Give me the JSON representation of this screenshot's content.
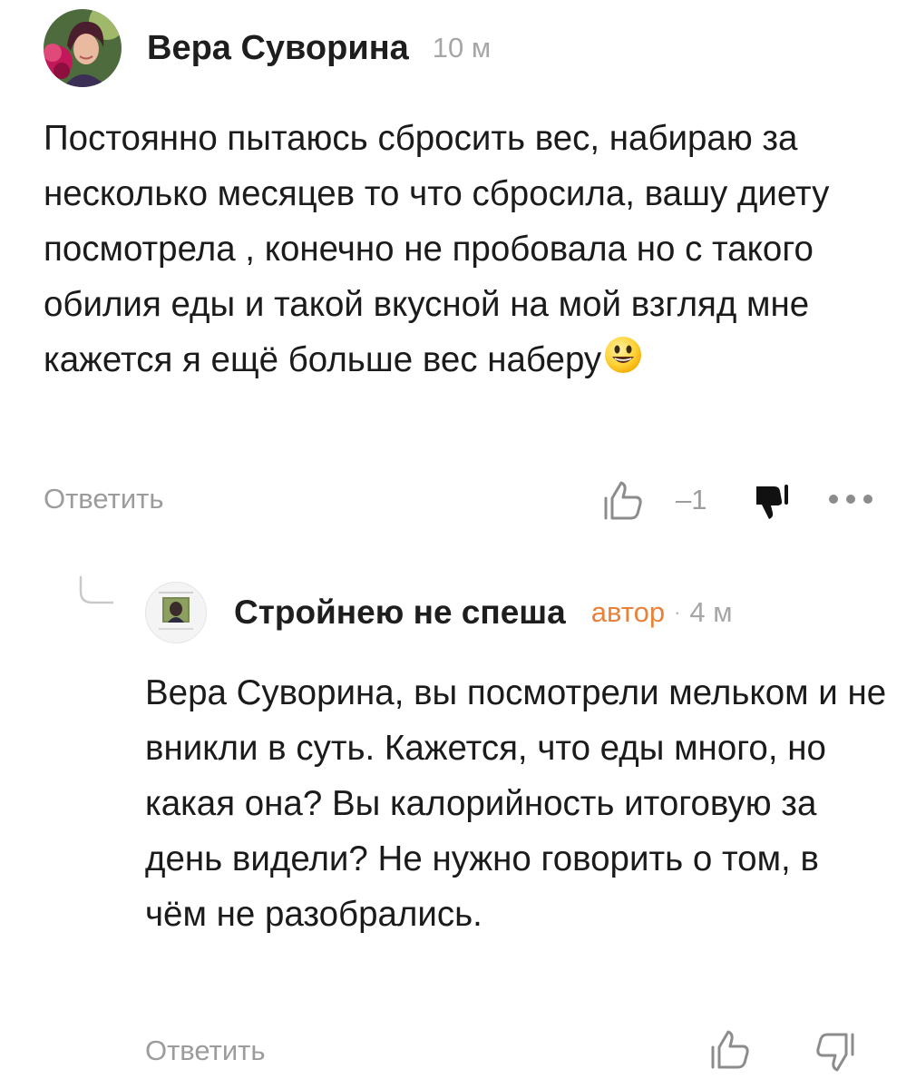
{
  "comments": [
    {
      "author": "Вера Суворина",
      "time": "10 м",
      "avatar_icon": "user-photo-avatar",
      "text": "Постоянно пытаюсь сбросить вес, набираю за несколько месяцев то что сбросила, вашу диету посмотрела , конечно не пробовала но с такого обилия еды и такой вкусной на мой взгляд мне кажется я ещё больше вес наберу",
      "emoji_icon": "smiling-face-emoji",
      "reply_label": "Ответить",
      "rating": "–1",
      "like_icon": "thumbs-up-outline-icon",
      "dislike_icon": "thumbs-down-filled-icon",
      "more_icon": "more-dots-icon"
    },
    {
      "author": "Стройнею не спеша",
      "badge": "автор",
      "separator": "·",
      "time": "4 м",
      "avatar_icon": "channel-avatar",
      "text": "Вера Суворина, вы посмотрели мельком и не вникли в суть. Кажется, что еды много, но какая она? Вы калорийность итоговую за день видели? Не нужно говорить о том, в чём не разобрались.",
      "reply_label": "Ответить",
      "like_icon": "thumbs-up-outline-icon",
      "dislike_icon": "thumbs-down-outline-icon"
    }
  ],
  "colors": {
    "text": "#1b1b1b",
    "muted": "#9c9c9c",
    "author_badge": "#e8823a",
    "dislike_active": "#111111"
  }
}
